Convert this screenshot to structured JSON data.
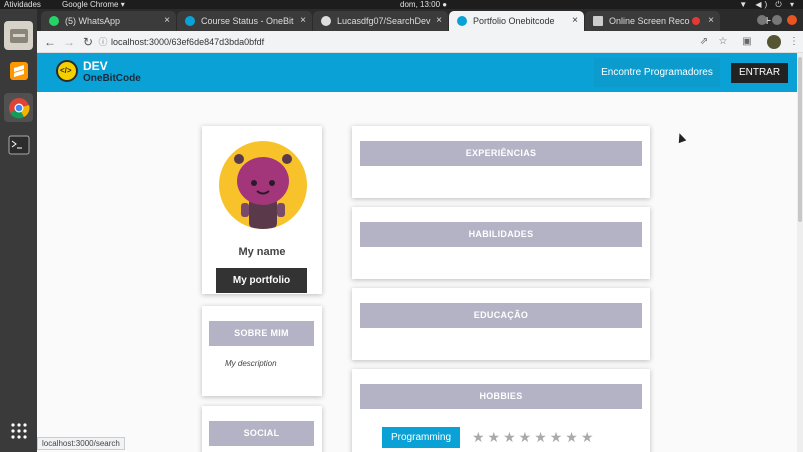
{
  "os_bar": {
    "activities": "Atividades",
    "app": "Google Chrome ▾",
    "clock": "dom, 13:00 ●",
    "tray": "▼ ◀) ⏻ ▾"
  },
  "tabs": [
    {
      "label": "(5) WhatsApp",
      "icon_color": "#25d366"
    },
    {
      "label": "Course Status - OneBit",
      "icon_color": "#0aa2d6"
    },
    {
      "label": "Lucasdfg07/SearchDev",
      "icon_color": "#dddddd"
    },
    {
      "label": "Portfolio Onebitcode",
      "icon_color": "#0aa2d6"
    },
    {
      "label": "Online Screen Reco",
      "icon_color": "#cccccc"
    }
  ],
  "tab_close": "×",
  "new_tab": "+",
  "toolbar": {
    "back": "←",
    "forward": "→",
    "reload": "↻",
    "url_icon": "ⓘ",
    "url": "localhost:3000/63ef6de847d3bda0bfdf",
    "share": "⇗",
    "star": "☆",
    "ext": "▣",
    "menu": "⋮"
  },
  "app": {
    "brand_line1": "DEV",
    "brand_line2": "OneBitCode",
    "find_devs": "Encontre Programadores",
    "login": "ENTRAR"
  },
  "profile": {
    "name": "My name",
    "portfolio_button": "My portfolio",
    "about_title": "SOBRE MIM",
    "description": "My description",
    "social_title": "SOCIAL"
  },
  "sections": {
    "experiences": "EXPERIÊNCIAS",
    "skills": "HABILIDADES",
    "education": "EDUCAÇÃO",
    "hobbies": "HOBBIES"
  },
  "hobby": {
    "name": "Programming",
    "stars": "★★★★★★★★",
    "rating": 0,
    "max_rating": 8
  },
  "status_url": "localhost:3000/search",
  "colors": {
    "accent": "#0aa2d6",
    "band": "#b4b2c5",
    "dark_button": "#222222"
  }
}
